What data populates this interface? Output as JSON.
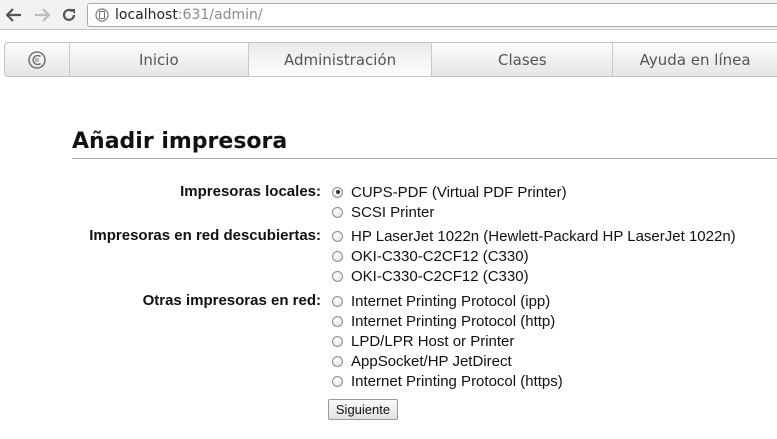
{
  "browser": {
    "url_host": "localhost",
    "url_rest": ":631/admin/",
    "back_icon": "back-arrow-icon",
    "forward_icon": "forward-arrow-icon",
    "reload_icon": "reload-icon",
    "page_icon": "page-icon"
  },
  "tabs": [
    {
      "label": "Inicio"
    },
    {
      "label": "Administración",
      "active": true
    },
    {
      "label": "Clases"
    },
    {
      "label": "Ayuda en línea"
    }
  ],
  "page": {
    "title": "Añadir impresora",
    "local_label": "Impresoras locales:",
    "local_printers": [
      {
        "label": "CUPS-PDF (Virtual PDF Printer)",
        "checked": true
      },
      {
        "label": "SCSI Printer",
        "checked": false
      }
    ],
    "discovered_label": "Impresoras en red descubiertas:",
    "discovered_printers": [
      {
        "label": "HP LaserJet 1022n (Hewlett-Packard HP LaserJet 1022n)"
      },
      {
        "label": "OKI-C330-C2CF12 (C330)"
      },
      {
        "label": "OKI-C330-C2CF12 (C330)"
      }
    ],
    "other_label": "Otras impresoras en red:",
    "other_printers": [
      {
        "label": "Internet Printing Protocol (ipp)"
      },
      {
        "label": "Internet Printing Protocol (http)"
      },
      {
        "label": "LPD/LPR Host or Printer"
      },
      {
        "label": "AppSocket/HP JetDirect"
      },
      {
        "label": "Internet Printing Protocol (https)"
      }
    ],
    "submit_label": "Siguiente"
  },
  "colors": {
    "toolbar_bg": "#f2f2f2",
    "tab_text": "#555555",
    "title_rule": "#b3b3b3"
  }
}
